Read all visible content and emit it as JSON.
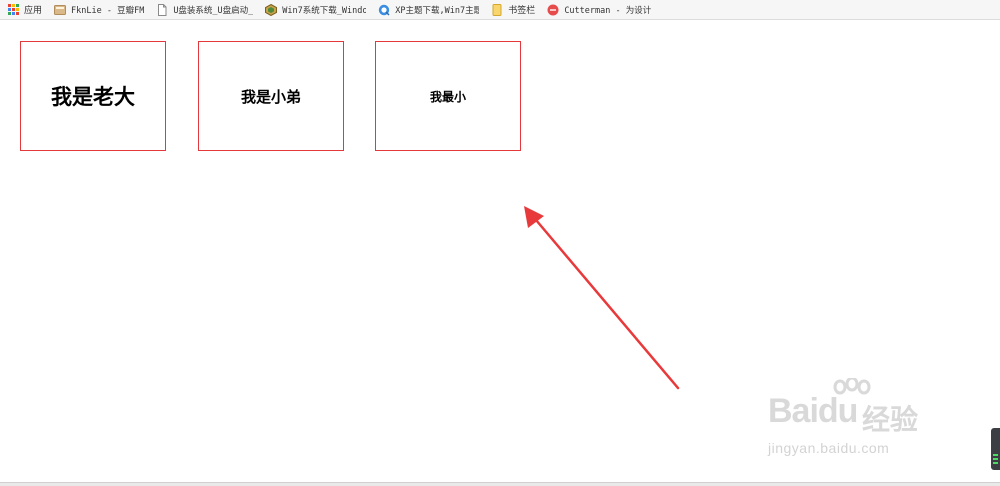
{
  "bookmarks": [
    {
      "label": "应用",
      "icon": "apps-grid-icon"
    },
    {
      "label": "FknLie - 豆瓣FM",
      "icon": "douban-fm-icon"
    },
    {
      "label": "U盘装系统_U盘启动_",
      "icon": "page-icon"
    },
    {
      "label": "Win7系统下载_Windo",
      "icon": "win7-icon"
    },
    {
      "label": "XP主题下载,Win7主题",
      "icon": "xp-theme-icon"
    },
    {
      "label": "书签栏",
      "icon": "folder-icon"
    },
    {
      "label": "Cutterman - 为设计",
      "icon": "cutterman-icon"
    }
  ],
  "boxes": [
    {
      "text": "我是老大"
    },
    {
      "text": "我是小弟"
    },
    {
      "text": "我最小"
    }
  ],
  "watermark": {
    "brand": "Baidu",
    "suffix": "经验",
    "url": "jingyan.baidu.com"
  },
  "colors": {
    "box_border": "#e4393c",
    "arrow": "#e8393b",
    "watermark": "#d9d9d9"
  }
}
